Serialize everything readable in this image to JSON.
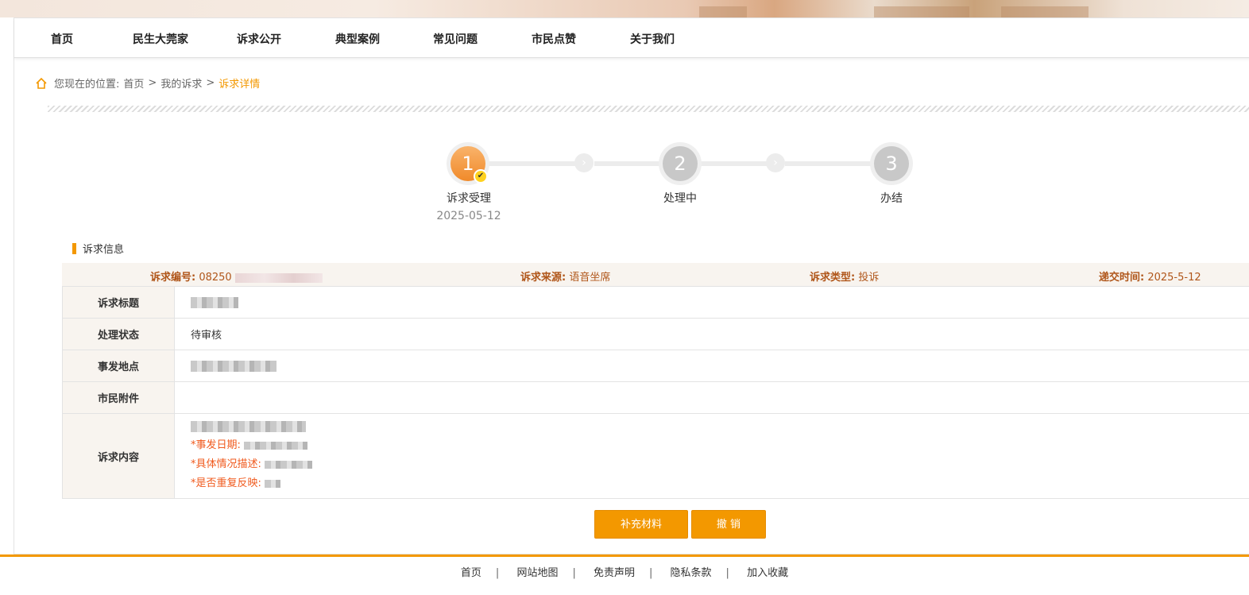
{
  "nav": {
    "items": [
      "首页",
      "民生大莞家",
      "诉求公开",
      "典型案例",
      "常见问题",
      "市民点赞",
      "关于我们"
    ]
  },
  "breadcrumb": {
    "prefix": "您现在的位置:",
    "items": [
      "首页",
      "我的诉求",
      "诉求详情"
    ],
    "separator": ">"
  },
  "steps": [
    {
      "number": "1",
      "label": "诉求受理",
      "date": "2025-05-12",
      "done": true
    },
    {
      "number": "2",
      "label": "处理中",
      "date": ""
    },
    {
      "number": "3",
      "label": "办结",
      "date": ""
    }
  ],
  "section_title": "诉求信息",
  "meta": {
    "id_label": "诉求编号:",
    "id_value": "08250",
    "source_label": "诉求来源:",
    "source_value": "语音坐席",
    "type_label": "诉求类型:",
    "type_value": "投诉",
    "time_label": "递交时间:",
    "time_value": "2025-5-12"
  },
  "rows": {
    "title_label": "诉求标题",
    "status_label": "处理状态",
    "status_value": "待审核",
    "location_label": "事发地点",
    "attachment_label": "市民附件",
    "content_label": "诉求内容",
    "content_lines": [
      "*事发日期:",
      "*具体情况描述:",
      "*是否重复反映:"
    ]
  },
  "buttons": {
    "supplement": "补充材料",
    "revoke": "撤 销"
  },
  "footer": [
    "首页",
    "网站地图",
    "免责声明",
    "隐私条款",
    "加入收藏"
  ],
  "colors": {
    "accent": "#f39800",
    "meta_text": "#b0561a",
    "content_red": "#f05a1e"
  }
}
